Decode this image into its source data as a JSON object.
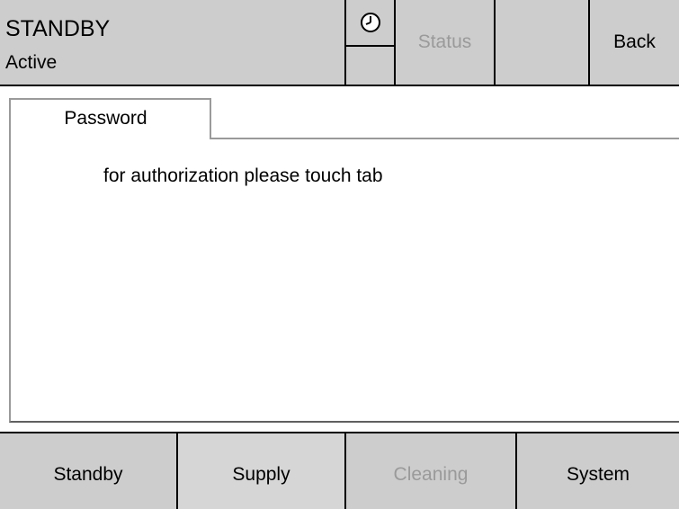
{
  "header": {
    "mode": "STANDBY",
    "state": "Active",
    "status_label": "Status",
    "back_label": "Back"
  },
  "tab": {
    "label": "Password",
    "message": "for authorization please touch tab"
  },
  "footer": {
    "buttons": [
      {
        "label": "Standby"
      },
      {
        "label": "Supply"
      },
      {
        "label": "Cleaning"
      },
      {
        "label": "System"
      }
    ]
  }
}
